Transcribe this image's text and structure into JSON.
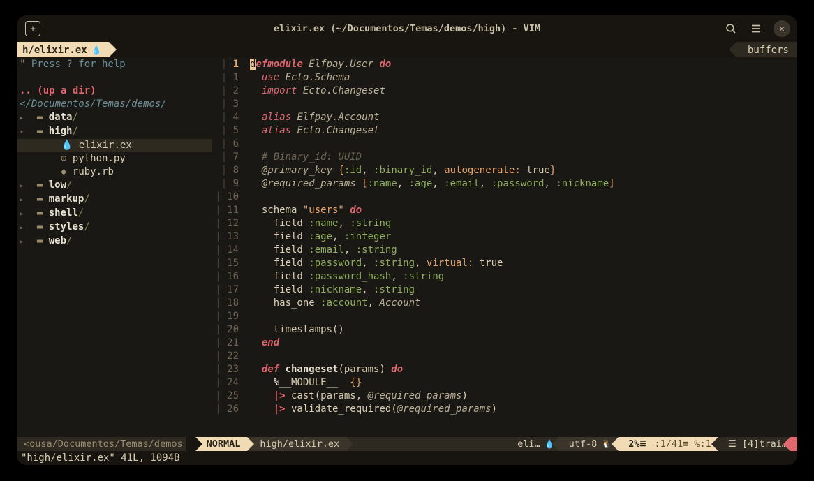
{
  "window": {
    "title": "elixir.ex (~/Documentos/Temas/demos/high) - VIM"
  },
  "tabline": {
    "active_tab": "h/elixir.ex",
    "buffers_label": "buffers"
  },
  "tree": {
    "help": "Press ? for help",
    "updir": ".. (up a dir)",
    "root": "/Documentos/Temas/demos/",
    "items": [
      {
        "type": "dir",
        "name": "data",
        "open": false,
        "depth": 0
      },
      {
        "type": "dir",
        "name": "high",
        "open": true,
        "depth": 0
      },
      {
        "type": "file",
        "name": "elixir.ex",
        "icon": "💧",
        "depth": 1,
        "selected": true
      },
      {
        "type": "file",
        "name": "python.py",
        "icon": "⊕",
        "depth": 1
      },
      {
        "type": "file",
        "name": "ruby.rb",
        "icon": "◆",
        "depth": 1
      },
      {
        "type": "dir",
        "name": "low",
        "open": false,
        "depth": 0
      },
      {
        "type": "dir",
        "name": "markup",
        "open": false,
        "depth": 0
      },
      {
        "type": "dir",
        "name": "shell",
        "open": false,
        "depth": 0
      },
      {
        "type": "dir",
        "name": "styles",
        "open": false,
        "depth": 0
      },
      {
        "type": "dir",
        "name": "web",
        "open": false,
        "depth": 0
      }
    ]
  },
  "code": {
    "current_line": 1,
    "lines": [
      {
        "n": 1,
        "tokens": [
          [
            "cursor",
            "d"
          ],
          [
            "kw",
            "efmodule "
          ],
          [
            "mod",
            "Elfpay.User "
          ],
          [
            "kw",
            "do"
          ]
        ]
      },
      {
        "n": 1,
        "rel": true,
        "tokens": [
          [
            "plain",
            "  "
          ],
          [
            "kw2",
            "use "
          ],
          [
            "mod",
            "Ecto.Schema"
          ]
        ]
      },
      {
        "n": 2,
        "rel": true,
        "tokens": [
          [
            "plain",
            "  "
          ],
          [
            "kw2",
            "import "
          ],
          [
            "mod",
            "Ecto.Changeset"
          ]
        ]
      },
      {
        "n": 3,
        "rel": true,
        "tokens": []
      },
      {
        "n": 4,
        "rel": true,
        "tokens": [
          [
            "plain",
            "  "
          ],
          [
            "kw2",
            "alias "
          ],
          [
            "mod",
            "Elfpay.Account"
          ]
        ]
      },
      {
        "n": 5,
        "rel": true,
        "tokens": [
          [
            "plain",
            "  "
          ],
          [
            "kw2",
            "alias "
          ],
          [
            "mod",
            "Ecto.Changeset"
          ]
        ]
      },
      {
        "n": 6,
        "rel": true,
        "tokens": []
      },
      {
        "n": 7,
        "rel": true,
        "tokens": [
          [
            "plain",
            "  "
          ],
          [
            "comment",
            "# Binary_id: UUID"
          ]
        ]
      },
      {
        "n": 8,
        "rel": true,
        "tokens": [
          [
            "plain",
            "  "
          ],
          [
            "attr",
            "@primary_key "
          ],
          [
            "brkt",
            "{"
          ],
          [
            "atom",
            ":id"
          ],
          [
            "punc",
            ", "
          ],
          [
            "atom",
            ":binary_id"
          ],
          [
            "punc",
            ", "
          ],
          [
            "str",
            "autogenerate: "
          ],
          [
            "bool",
            "true"
          ],
          [
            "brkt",
            "}"
          ]
        ]
      },
      {
        "n": 9,
        "rel": true,
        "tokens": [
          [
            "plain",
            "  "
          ],
          [
            "attr",
            "@required_params "
          ],
          [
            "brkt",
            "["
          ],
          [
            "atom",
            ":name"
          ],
          [
            "punc",
            ", "
          ],
          [
            "atom",
            ":age"
          ],
          [
            "punc",
            ", "
          ],
          [
            "atom",
            ":email"
          ],
          [
            "punc",
            ", "
          ],
          [
            "atom",
            ":password"
          ],
          [
            "punc",
            ", "
          ],
          [
            "atom",
            ":nickname"
          ],
          [
            "brkt",
            "]"
          ]
        ]
      },
      {
        "n": 10,
        "rel": true,
        "tokens": []
      },
      {
        "n": 11,
        "rel": true,
        "tokens": [
          [
            "plain",
            "  schema "
          ],
          [
            "str",
            "\"users\" "
          ],
          [
            "kw",
            "do"
          ]
        ]
      },
      {
        "n": 12,
        "rel": true,
        "tokens": [
          [
            "plain",
            "    field "
          ],
          [
            "atom",
            ":name"
          ],
          [
            "punc",
            ", "
          ],
          [
            "atom",
            ":string"
          ]
        ]
      },
      {
        "n": 13,
        "rel": true,
        "tokens": [
          [
            "plain",
            "    field "
          ],
          [
            "atom",
            ":age"
          ],
          [
            "punc",
            ", "
          ],
          [
            "atom",
            ":integer"
          ]
        ]
      },
      {
        "n": 14,
        "rel": true,
        "tokens": [
          [
            "plain",
            "    field "
          ],
          [
            "atom",
            ":email"
          ],
          [
            "punc",
            ", "
          ],
          [
            "atom",
            ":string"
          ]
        ]
      },
      {
        "n": 15,
        "rel": true,
        "tokens": [
          [
            "plain",
            "    field "
          ],
          [
            "atom",
            ":password"
          ],
          [
            "punc",
            ", "
          ],
          [
            "atom",
            ":string"
          ],
          [
            "punc",
            ", "
          ],
          [
            "str",
            "virtual: "
          ],
          [
            "bool",
            "true"
          ]
        ]
      },
      {
        "n": 16,
        "rel": true,
        "tokens": [
          [
            "plain",
            "    field "
          ],
          [
            "atom",
            ":password_hash"
          ],
          [
            "punc",
            ", "
          ],
          [
            "atom",
            ":string"
          ]
        ]
      },
      {
        "n": 17,
        "rel": true,
        "tokens": [
          [
            "plain",
            "    field "
          ],
          [
            "atom",
            ":nickname"
          ],
          [
            "punc",
            ", "
          ],
          [
            "atom",
            ":string"
          ]
        ]
      },
      {
        "n": 18,
        "rel": true,
        "tokens": [
          [
            "plain",
            "    has_one "
          ],
          [
            "atom",
            ":account"
          ],
          [
            "punc",
            ", "
          ],
          [
            "mod",
            "Account"
          ]
        ]
      },
      {
        "n": 19,
        "rel": true,
        "tokens": []
      },
      {
        "n": 20,
        "rel": true,
        "tokens": [
          [
            "plain",
            "    timestamps()"
          ]
        ]
      },
      {
        "n": 21,
        "rel": true,
        "tokens": [
          [
            "plain",
            "  "
          ],
          [
            "kw",
            "end"
          ]
        ]
      },
      {
        "n": 22,
        "rel": true,
        "tokens": []
      },
      {
        "n": 23,
        "rel": true,
        "tokens": [
          [
            "plain",
            "  "
          ],
          [
            "kw",
            "def "
          ],
          [
            "func",
            "changeset"
          ],
          [
            "plain",
            "(params) "
          ],
          [
            "kw",
            "do"
          ]
        ]
      },
      {
        "n": 24,
        "rel": true,
        "tokens": [
          [
            "plain",
            "    "
          ],
          [
            "func",
            "%"
          ],
          [
            "plain",
            "__MODULE__  "
          ],
          [
            "brkt",
            "{}"
          ]
        ]
      },
      {
        "n": 25,
        "rel": true,
        "tokens": [
          [
            "plain",
            "    "
          ],
          [
            "pipe",
            "|>"
          ],
          [
            "plain",
            " cast(params, "
          ],
          [
            "attr",
            "@required_params"
          ],
          [
            "plain",
            ")"
          ]
        ]
      },
      {
        "n": 26,
        "rel": true,
        "tokens": [
          [
            "plain",
            "    "
          ],
          [
            "pipe",
            "|>"
          ],
          [
            "plain",
            " validate_required("
          ],
          [
            "attr",
            "@required_params"
          ],
          [
            "plain",
            ")"
          ]
        ]
      }
    ]
  },
  "status": {
    "tree_path": "<ousa/Documentos/Temas/demos",
    "mode": "NORMAL",
    "file": "high/elixir.ex",
    "filetype": "eli…",
    "encoding": "utf-8",
    "percent": "2%",
    "position": ":1/41≡ %:1",
    "trailing": "☰ [4]trai…"
  },
  "cmdline": "\"high/elixir.ex\" 41L, 1094B"
}
